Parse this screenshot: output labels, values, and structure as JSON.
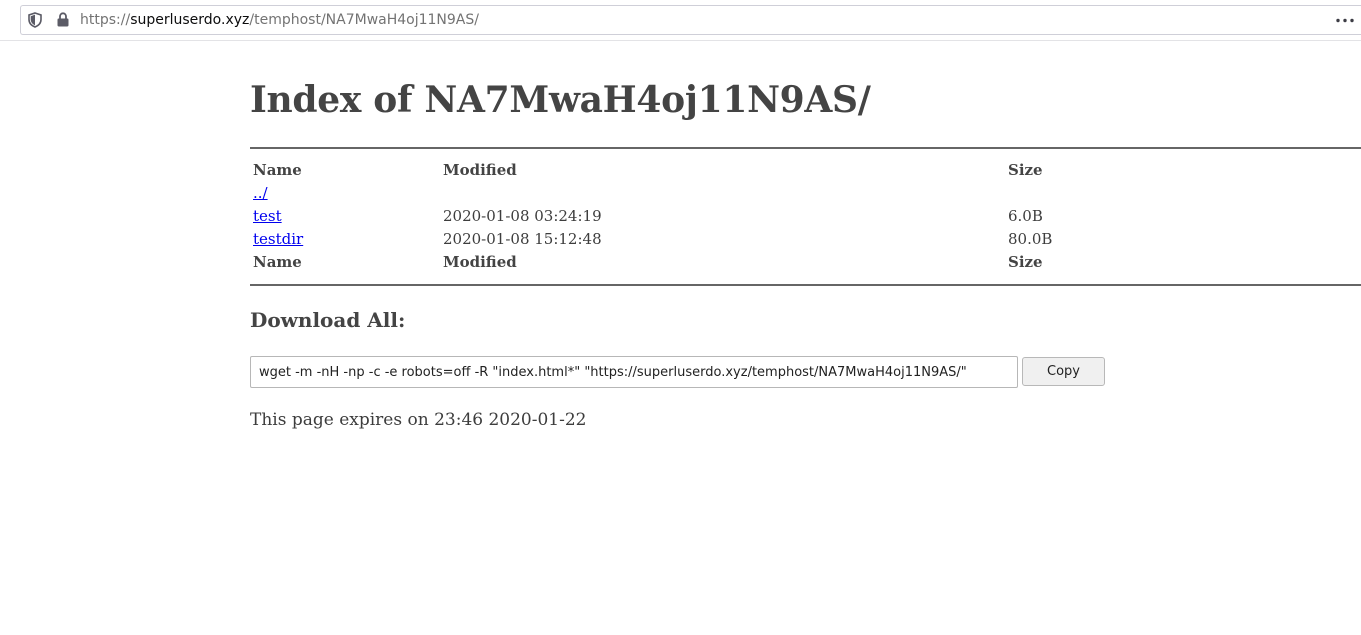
{
  "browser": {
    "url_prefix": "https://",
    "url_host": "superluserdo.xyz",
    "url_path": "/temphost/NA7MwaH4oj11N9AS/"
  },
  "page": {
    "title": "Index of NA7MwaH4oj11N9AS/",
    "table": {
      "headers": {
        "name": "Name",
        "modified": "Modified",
        "size": "Size"
      },
      "rows": [
        {
          "name": "../",
          "modified": "",
          "size": ""
        },
        {
          "name": "test",
          "modified": "2020-01-08 03:24:19",
          "size": "6.0B"
        },
        {
          "name": "testdir",
          "modified": "2020-01-08 15:12:48",
          "size": "80.0B"
        }
      ],
      "footers": {
        "name": "Name",
        "modified": "Modified",
        "size": "Size"
      }
    },
    "download": {
      "heading": "Download All:",
      "command": "wget -m -nH -np -c -e robots=off -R \"index.html*\" \"https://superluserdo.xyz/temphost/NA7MwaH4oj11N9AS/\"",
      "copy_label": "Copy"
    },
    "expires_text": "This page expires on 23:46 2020-01-22"
  },
  "icons": {
    "shield": "tracking-protection-shield-icon",
    "lock": "secure-lock-icon",
    "menu": "page-actions-dots-icon"
  }
}
